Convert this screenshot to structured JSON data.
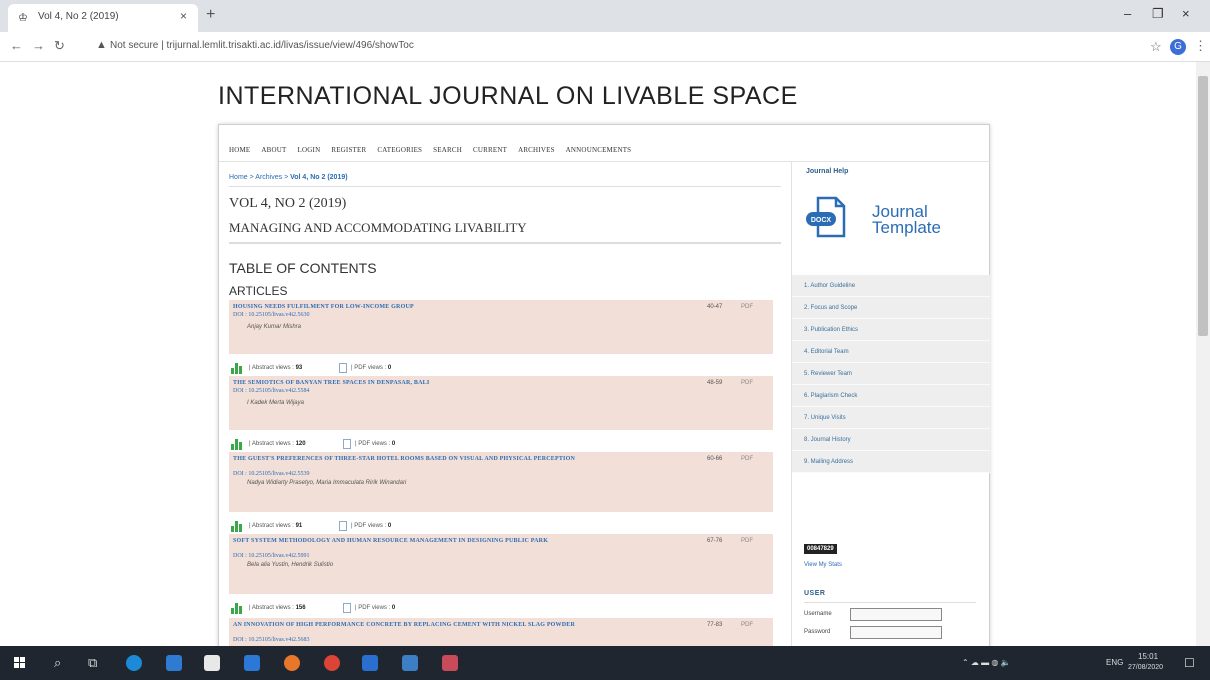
{
  "browser": {
    "tab_title": "Vol 4, No 2 (2019)",
    "tab_close": "×",
    "new_tab": "+",
    "not_secure": "Not secure",
    "url": "trijurnal.lemlit.trisakti.ac.id/livas/issue/view/496/showToc",
    "window_min": "–",
    "window_max": "❐",
    "window_close": "×",
    "avatar_letter": "G"
  },
  "site": {
    "title": "INTERNATIONAL JOURNAL ON LIVABLE SPACE",
    "nav": [
      "HOME",
      "ABOUT",
      "LOGIN",
      "REGISTER",
      "CATEGORIES",
      "SEARCH",
      "CURRENT",
      "ARCHIVES",
      "ANNOUNCEMENTS"
    ]
  },
  "breadcrumb": {
    "home": "Home",
    "sep1": " > ",
    "archives": "Archives",
    "sep2": " > ",
    "current": "Vol 4, No 2 (2019)"
  },
  "issue": {
    "volume": "VOL 4, NO 2 (2019)",
    "subtitle": "MANAGING AND ACCOMMODATING LIVABILITY",
    "toc_heading": "TABLE OF CONTENTS",
    "section": "ARTICLES"
  },
  "articles": [
    {
      "title": "HOUSING NEEDS FULFILMENT FOR LOW-INCOME GROUP",
      "doi": "DOI : 10.25105/livas.v4i2.5630",
      "authors": "Anjay Kumar Mishra",
      "pages": "40-47",
      "pdf": "PDF",
      "abstract_views_label": "| Abstract views : ",
      "abstract_views": "93",
      "pdf_views_label": "| PDF views : ",
      "pdf_views": "0"
    },
    {
      "title": "THE SEMIOTICS OF BANYAN TREE SPACES IN DENPASAR, BALI",
      "doi": "DOI : 10.25105/livas.v4i2.5584",
      "authors": "I Kadek Merta Wijaya",
      "pages": "48-59",
      "pdf": "PDF",
      "abstract_views_label": "| Abstract views : ",
      "abstract_views": "120",
      "pdf_views_label": "| PDF views : ",
      "pdf_views": "0"
    },
    {
      "title": "THE GUEST'S PREFERENCES OF THREE-STAR HOTEL ROOMS BASED ON VISUAL AND PHYSICAL PERCEPTION",
      "doi": "DOI : 10.25105/livas.v4i2.5539",
      "authors": "Nadya Widiarty Prasetyo, Maria Immaculata Ririk Winandari",
      "pages": "60-66",
      "pdf": "PDF",
      "abstract_views_label": "| Abstract views : ",
      "abstract_views": "91",
      "pdf_views_label": "| PDF views : ",
      "pdf_views": "0"
    },
    {
      "title": "SOFT SYSTEM METHODOLOGY AND HUMAN RESOURCE MANAGEMENT IN DESIGNING PUBLIC PARK",
      "doi": "DOI : 10.25105/livas.v4i2.5991",
      "authors": "Bela alia Yustin, Hendrik Sulistio",
      "pages": "67-76",
      "pdf": "PDF",
      "abstract_views_label": "| Abstract views : ",
      "abstract_views": "156",
      "pdf_views_label": "| PDF views : ",
      "pdf_views": "0"
    },
    {
      "title": "AN INNOVATION OF HIGH PERFORMANCE CONCRETE BY REPLACING CEMENT WITH NICKEL SLAG POWDER",
      "doi": "DOI : 10.25105/livas.v4i2.5683",
      "pages": "77-83",
      "pdf": "PDF"
    }
  ],
  "sidebar": {
    "journal_help": "Journal Help",
    "template_line1": "Journal",
    "template_line2": "Template",
    "template_badge": "DOCX",
    "menu": [
      "1. Author Guideline",
      "2. Focus and Scope",
      "3. Publication Ethics",
      "4. Editorial Team",
      "5. Reviewer Team",
      "6. Plagiarism Check",
      "7. Unique Visits",
      "8. Journal History",
      "9. Mailing Address"
    ],
    "counter": "00847829",
    "view_stats": "View My Stats",
    "user_heading": "USER",
    "username_label": "Username",
    "password_label": "Password"
  },
  "taskbar": {
    "lang": "ENG",
    "time": "15:01",
    "date": "27/08/2020"
  }
}
